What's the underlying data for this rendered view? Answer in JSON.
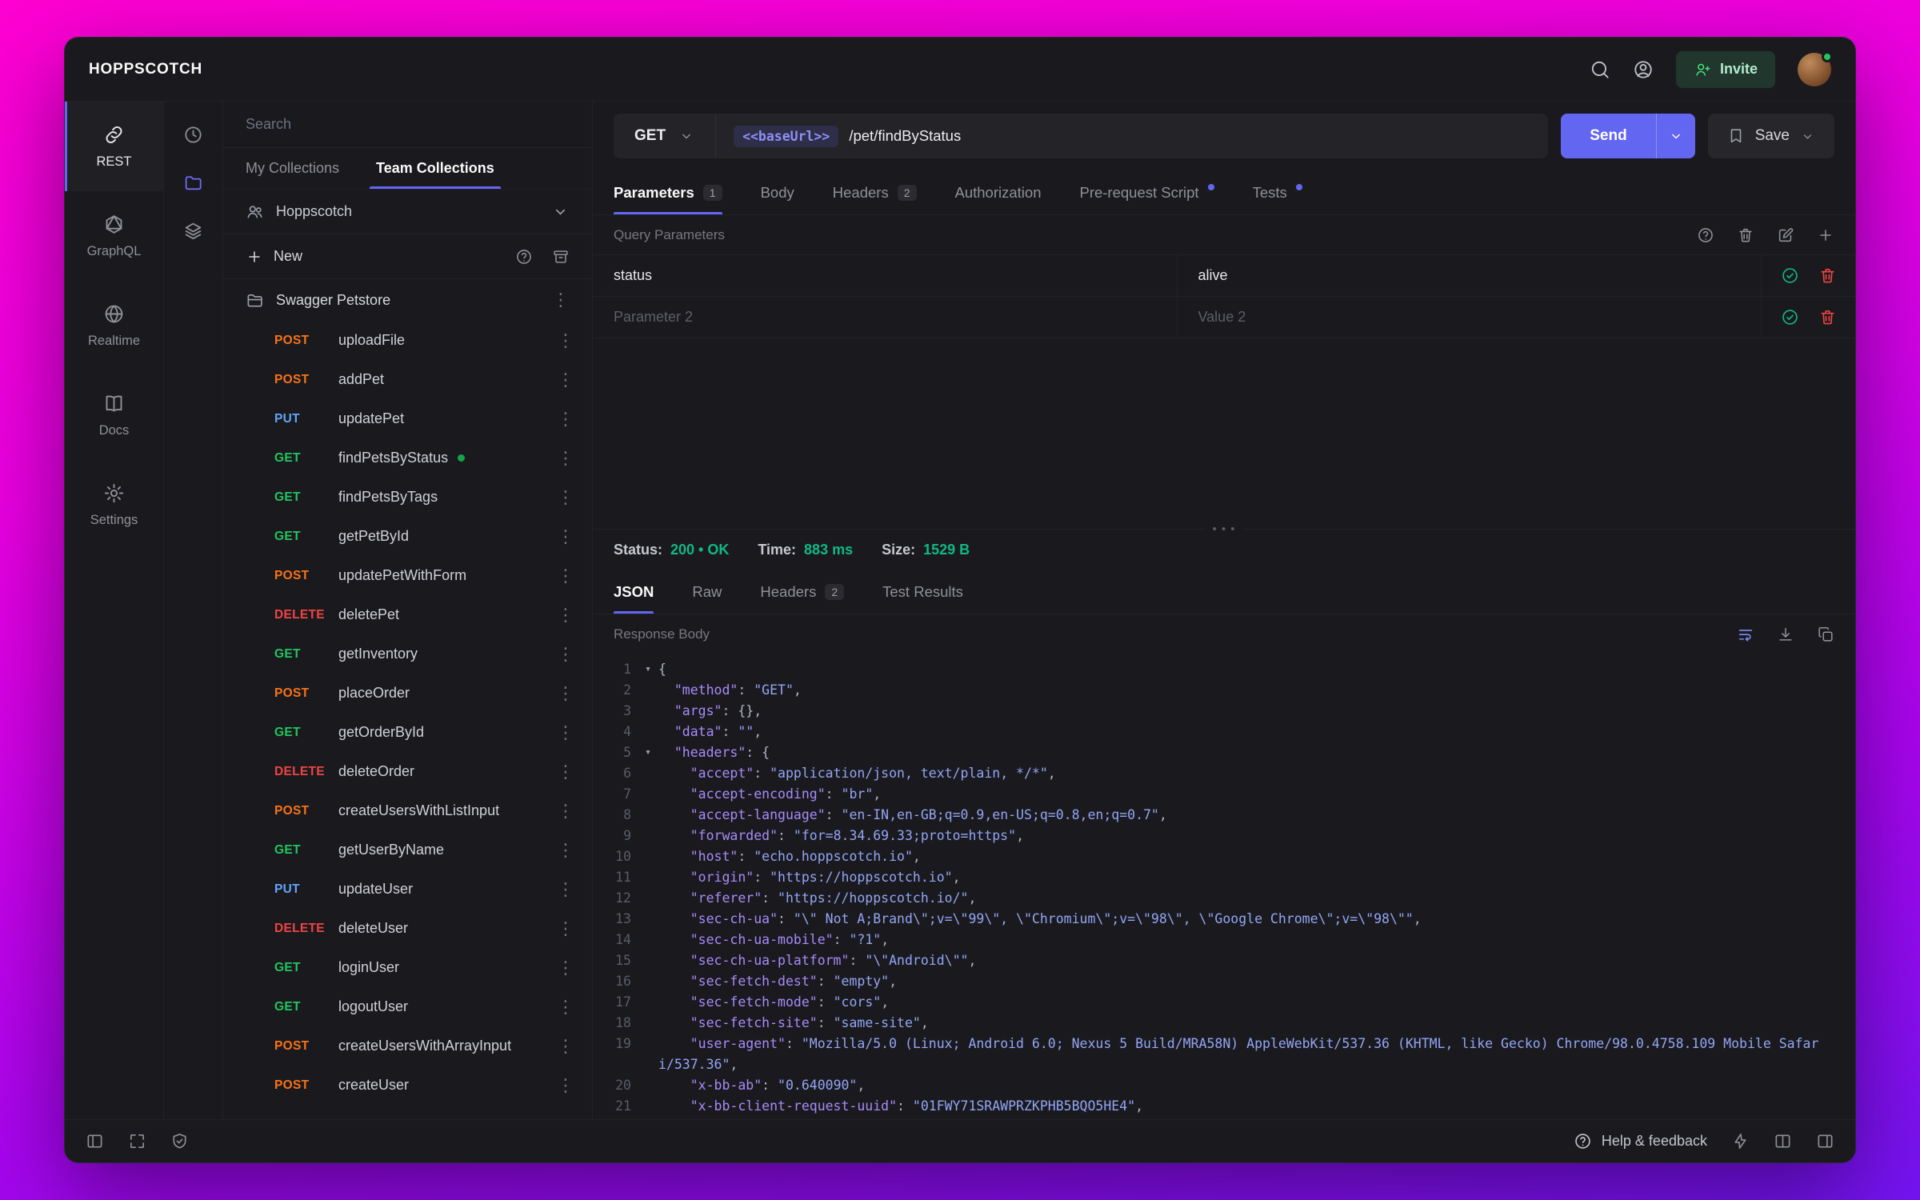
{
  "app": {
    "title": "HOPPSCOTCH",
    "accent_color": "#6366f1"
  },
  "topbar": {
    "invite_label": "Invite",
    "icons": [
      "search",
      "user-circle"
    ]
  },
  "left_nav": {
    "items": [
      {
        "label": "REST",
        "icon": "link",
        "active": true
      },
      {
        "label": "GraphQL",
        "icon": "graphql",
        "active": false
      },
      {
        "label": "Realtime",
        "icon": "globe",
        "active": false
      },
      {
        "label": "Docs",
        "icon": "book",
        "active": false
      },
      {
        "label": "Settings",
        "icon": "gear",
        "active": false
      }
    ]
  },
  "side_strip": {
    "icons": [
      "history",
      "collections",
      "environments"
    ],
    "active": "collections"
  },
  "collections": {
    "search_placeholder": "Search",
    "tabs": [
      {
        "label": "My Collections",
        "active": false
      },
      {
        "label": "Team Collections",
        "active": true
      }
    ],
    "team_name": "Hoppscotch",
    "new_label": "New",
    "folder_name": "Swagger Petstore",
    "requests": [
      {
        "method": "POST",
        "name": "uploadFile"
      },
      {
        "method": "POST",
        "name": "addPet"
      },
      {
        "method": "PUT",
        "name": "updatePet"
      },
      {
        "method": "GET",
        "name": "findPetsByStatus",
        "dot": true
      },
      {
        "method": "GET",
        "name": "findPetsByTags"
      },
      {
        "method": "GET",
        "name": "getPetById"
      },
      {
        "method": "POST",
        "name": "updatePetWithForm"
      },
      {
        "method": "DELETE",
        "name": "deletePet"
      },
      {
        "method": "GET",
        "name": "getInventory"
      },
      {
        "method": "POST",
        "name": "placeOrder"
      },
      {
        "method": "GET",
        "name": "getOrderById"
      },
      {
        "method": "DELETE",
        "name": "deleteOrder"
      },
      {
        "method": "POST",
        "name": "createUsersWithListInput"
      },
      {
        "method": "GET",
        "name": "getUserByName"
      },
      {
        "method": "PUT",
        "name": "updateUser"
      },
      {
        "method": "DELETE",
        "name": "deleteUser"
      },
      {
        "method": "GET",
        "name": "loginUser"
      },
      {
        "method": "GET",
        "name": "logoutUser"
      },
      {
        "method": "POST",
        "name": "createUsersWithArrayInput"
      },
      {
        "method": "POST",
        "name": "createUser"
      }
    ]
  },
  "request": {
    "method": "GET",
    "base_url": "<<baseUrl>>",
    "path": "/pet/findByStatus",
    "send_label": "Send",
    "save_label": "Save"
  },
  "request_tabs": [
    {
      "label": "Parameters",
      "badge": "1",
      "active": true
    },
    {
      "label": "Body"
    },
    {
      "label": "Headers",
      "badge": "2"
    },
    {
      "label": "Authorization"
    },
    {
      "label": "Pre-request Script",
      "dot": true
    },
    {
      "label": "Tests",
      "dot": true
    }
  ],
  "params": {
    "title": "Query Parameters",
    "rows": [
      {
        "key": "status",
        "value": "alive"
      },
      {
        "key_placeholder": "Parameter 2",
        "value_placeholder": "Value 2"
      }
    ]
  },
  "response": {
    "status_label": "Status:",
    "status_value": "200 • OK",
    "time_label": "Time:",
    "time_value": "883 ms",
    "size_label": "Size:",
    "size_value": "1529 B",
    "tabs": [
      {
        "label": "JSON",
        "active": true
      },
      {
        "label": "Raw"
      },
      {
        "label": "Headers",
        "badge": "2"
      },
      {
        "label": "Test Results"
      }
    ],
    "body_title": "Response Body",
    "body_lines": [
      {
        "n": 1,
        "f": true,
        "t": [
          {
            "c": "p",
            "v": "{"
          }
        ]
      },
      {
        "n": 2,
        "t": [
          {
            "c": "p",
            "v": "  "
          },
          {
            "c": "k",
            "v": "\"method\""
          },
          {
            "c": "p",
            "v": ": "
          },
          {
            "c": "s",
            "v": "\"GET\""
          },
          {
            "c": "p",
            "v": ","
          }
        ]
      },
      {
        "n": 3,
        "t": [
          {
            "c": "p",
            "v": "  "
          },
          {
            "c": "k",
            "v": "\"args\""
          },
          {
            "c": "p",
            "v": ": {},"
          }
        ]
      },
      {
        "n": 4,
        "t": [
          {
            "c": "p",
            "v": "  "
          },
          {
            "c": "k",
            "v": "\"data\""
          },
          {
            "c": "p",
            "v": ": "
          },
          {
            "c": "s",
            "v": "\"\""
          },
          {
            "c": "p",
            "v": ","
          }
        ]
      },
      {
        "n": 5,
        "f": true,
        "t": [
          {
            "c": "p",
            "v": "  "
          },
          {
            "c": "k",
            "v": "\"headers\""
          },
          {
            "c": "p",
            "v": ": {"
          }
        ]
      },
      {
        "n": 6,
        "t": [
          {
            "c": "p",
            "v": "    "
          },
          {
            "c": "k",
            "v": "\"accept\""
          },
          {
            "c": "p",
            "v": ": "
          },
          {
            "c": "s",
            "v": "\"application/json, text/plain, */*\""
          },
          {
            "c": "p",
            "v": ","
          }
        ]
      },
      {
        "n": 7,
        "t": [
          {
            "c": "p",
            "v": "    "
          },
          {
            "c": "k",
            "v": "\"accept-encoding\""
          },
          {
            "c": "p",
            "v": ": "
          },
          {
            "c": "s",
            "v": "\"br\""
          },
          {
            "c": "p",
            "v": ","
          }
        ]
      },
      {
        "n": 8,
        "t": [
          {
            "c": "p",
            "v": "    "
          },
          {
            "c": "k",
            "v": "\"accept-language\""
          },
          {
            "c": "p",
            "v": ": "
          },
          {
            "c": "s",
            "v": "\"en-IN,en-GB;q=0.9,en-US;q=0.8,en;q=0.7\""
          },
          {
            "c": "p",
            "v": ","
          }
        ]
      },
      {
        "n": 9,
        "t": [
          {
            "c": "p",
            "v": "    "
          },
          {
            "c": "k",
            "v": "\"forwarded\""
          },
          {
            "c": "p",
            "v": ": "
          },
          {
            "c": "s",
            "v": "\"for=8.34.69.33;proto=https\""
          },
          {
            "c": "p",
            "v": ","
          }
        ]
      },
      {
        "n": 10,
        "t": [
          {
            "c": "p",
            "v": "    "
          },
          {
            "c": "k",
            "v": "\"host\""
          },
          {
            "c": "p",
            "v": ": "
          },
          {
            "c": "s",
            "v": "\"echo.hoppscotch.io\""
          },
          {
            "c": "p",
            "v": ","
          }
        ]
      },
      {
        "n": 11,
        "t": [
          {
            "c": "p",
            "v": "    "
          },
          {
            "c": "k",
            "v": "\"origin\""
          },
          {
            "c": "p",
            "v": ": "
          },
          {
            "c": "s",
            "v": "\"https://hoppscotch.io\""
          },
          {
            "c": "p",
            "v": ","
          }
        ]
      },
      {
        "n": 12,
        "t": [
          {
            "c": "p",
            "v": "    "
          },
          {
            "c": "k",
            "v": "\"referer\""
          },
          {
            "c": "p",
            "v": ": "
          },
          {
            "c": "s",
            "v": "\"https://hoppscotch.io/\""
          },
          {
            "c": "p",
            "v": ","
          }
        ]
      },
      {
        "n": 13,
        "t": [
          {
            "c": "p",
            "v": "    "
          },
          {
            "c": "k",
            "v": "\"sec-ch-ua\""
          },
          {
            "c": "p",
            "v": ": "
          },
          {
            "c": "s",
            "v": "\"\\\" Not A;Brand\\\";v=\\\"99\\\", \\\"Chromium\\\";v=\\\"98\\\", \\\"Google Chrome\\\";v=\\\"98\\\"\""
          },
          {
            "c": "p",
            "v": ","
          }
        ]
      },
      {
        "n": 14,
        "t": [
          {
            "c": "p",
            "v": "    "
          },
          {
            "c": "k",
            "v": "\"sec-ch-ua-mobile\""
          },
          {
            "c": "p",
            "v": ": "
          },
          {
            "c": "s",
            "v": "\"?1\""
          },
          {
            "c": "p",
            "v": ","
          }
        ]
      },
      {
        "n": 15,
        "t": [
          {
            "c": "p",
            "v": "    "
          },
          {
            "c": "k",
            "v": "\"sec-ch-ua-platform\""
          },
          {
            "c": "p",
            "v": ": "
          },
          {
            "c": "s",
            "v": "\"\\\"Android\\\"\""
          },
          {
            "c": "p",
            "v": ","
          }
        ]
      },
      {
        "n": 16,
        "t": [
          {
            "c": "p",
            "v": "    "
          },
          {
            "c": "k",
            "v": "\"sec-fetch-dest\""
          },
          {
            "c": "p",
            "v": ": "
          },
          {
            "c": "s",
            "v": "\"empty\""
          },
          {
            "c": "p",
            "v": ","
          }
        ]
      },
      {
        "n": 17,
        "t": [
          {
            "c": "p",
            "v": "    "
          },
          {
            "c": "k",
            "v": "\"sec-fetch-mode\""
          },
          {
            "c": "p",
            "v": ": "
          },
          {
            "c": "s",
            "v": "\"cors\""
          },
          {
            "c": "p",
            "v": ","
          }
        ]
      },
      {
        "n": 18,
        "t": [
          {
            "c": "p",
            "v": "    "
          },
          {
            "c": "k",
            "v": "\"sec-fetch-site\""
          },
          {
            "c": "p",
            "v": ": "
          },
          {
            "c": "s",
            "v": "\"same-site\""
          },
          {
            "c": "p",
            "v": ","
          }
        ]
      },
      {
        "n": 19,
        "t": [
          {
            "c": "p",
            "v": "    "
          },
          {
            "c": "k",
            "v": "\"user-agent\""
          },
          {
            "c": "p",
            "v": ": "
          },
          {
            "c": "s",
            "v": "\"Mozilla/5.0 (Linux; Android 6.0; Nexus 5 Build/MRA58N) AppleWebKit/537.36 (KHTML, like Gecko) Chrome/98.0.4758.109 Mobile Safari/537.36\""
          },
          {
            "c": "p",
            "v": ","
          }
        ]
      },
      {
        "n": 20,
        "t": [
          {
            "c": "p",
            "v": "    "
          },
          {
            "c": "k",
            "v": "\"x-bb-ab\""
          },
          {
            "c": "p",
            "v": ": "
          },
          {
            "c": "s",
            "v": "\"0.640090\""
          },
          {
            "c": "p",
            "v": ","
          }
        ]
      },
      {
        "n": 21,
        "t": [
          {
            "c": "p",
            "v": "    "
          },
          {
            "c": "k",
            "v": "\"x-bb-client-request-uuid\""
          },
          {
            "c": "p",
            "v": ": "
          },
          {
            "c": "s",
            "v": "\"01FWY71SRAWPRZKPHB5BQO5HE4\""
          },
          {
            "c": "p",
            "v": ","
          }
        ]
      }
    ]
  },
  "bottom_bar": {
    "help_label": "Help & feedback"
  }
}
